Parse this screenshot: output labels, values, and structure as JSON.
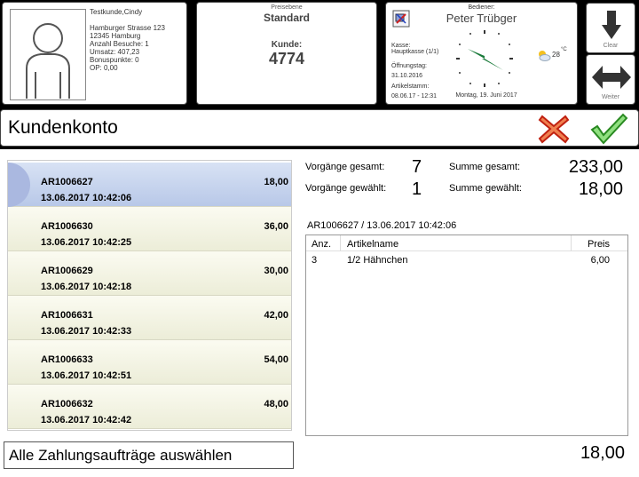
{
  "customer": {
    "name": "Testkunde,Cindy",
    "street": "Hamburger Strasse 123",
    "city": "12345 Hamburg",
    "visits": "Anzahl Besuche: 1",
    "revenue": "Umsatz: 407,23",
    "bonus": "Bonuspunkte: 0",
    "op": "OP: 0,00"
  },
  "price_level": {
    "label": "Preisebene",
    "value": "Standard",
    "customer_label": "Kunde:",
    "customer_no": "4774"
  },
  "operator": {
    "label": "Bediener:",
    "name": "Peter Trübger",
    "kasse_label": "Kasse:",
    "kasse_value": "Hauptkasse (1/1)",
    "opening_label": "Öffnungstag:",
    "opening_value": "31.10.2016",
    "article_label": "Artikelstamm:",
    "article_value": "08.06.17 - 12:31",
    "date": "Montag, 19. Juni 2017",
    "temperature": "28",
    "temp_unit": "°C"
  },
  "nav": {
    "clear_label": "Clear",
    "next_label": "Weiter"
  },
  "title": "Kundenkonto",
  "orders": [
    {
      "id": "AR1006627",
      "datetime": "13.06.2017 10:42:06",
      "amount": "18,00"
    },
    {
      "id": "AR1006630",
      "datetime": "13.06.2017 10:42:25",
      "amount": "36,00"
    },
    {
      "id": "AR1006629",
      "datetime": "13.06.2017 10:42:18",
      "amount": "30,00"
    },
    {
      "id": "AR1006631",
      "datetime": "13.06.2017 10:42:33",
      "amount": "42,00"
    },
    {
      "id": "AR1006633",
      "datetime": "13.06.2017 10:42:51",
      "amount": "54,00"
    },
    {
      "id": "AR1006632",
      "datetime": "13.06.2017 10:42:42",
      "amount": "48,00"
    }
  ],
  "stats": {
    "total_label": "Vorgänge gesamt:",
    "total_count": "7",
    "selected_label": "Vorgänge gewählt:",
    "selected_count": "1",
    "sum_total_label": "Summe gesamt:",
    "sum_total": "233,00",
    "sum_selected_label": "Summe gewählt:",
    "sum_selected": "18,00"
  },
  "detail": {
    "heading": "AR1006627 / 13.06.2017 10:42:06",
    "col_qty": "Anz.",
    "col_name": "Artikelname",
    "col_price": "Preis",
    "items": [
      {
        "qty": "3",
        "name": "1/2 Hähnchen",
        "price": "6,00"
      }
    ]
  },
  "select_all_label": "Alle Zahlungsaufträge auswählen",
  "footer_total": "18,00",
  "colors": {
    "cancel": "#e8401c",
    "confirm": "#3aa832",
    "selected_row": "#b8c8e8"
  }
}
